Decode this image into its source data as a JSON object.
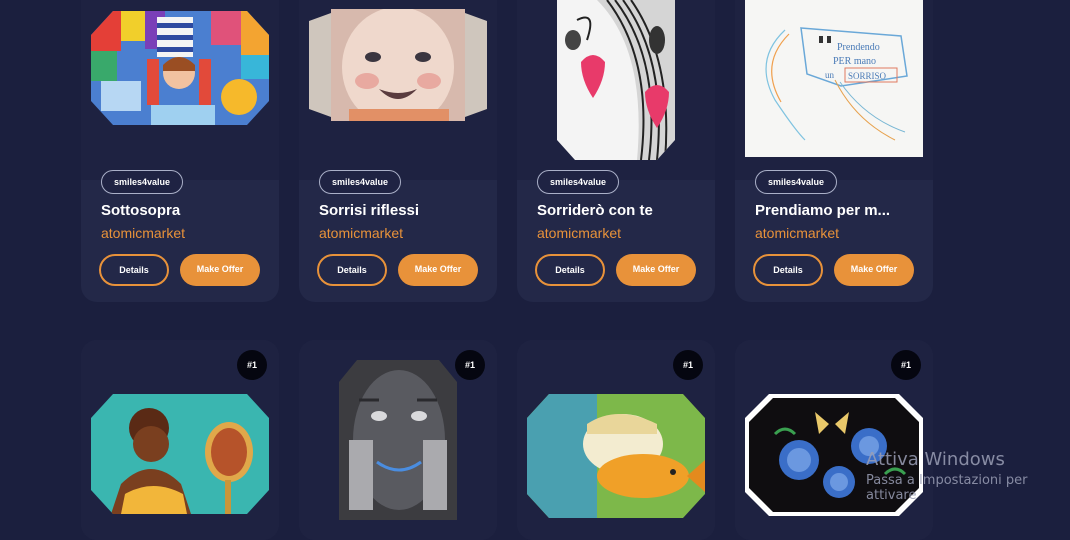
{
  "cards_row1": [
    {
      "collection": "smiles4value",
      "title": "Sottosopra",
      "seller": "atomicmarket",
      "details_label": "Details",
      "offer_label": "Make Offer"
    },
    {
      "collection": "smiles4value",
      "title": "Sorrisi riflessi",
      "seller": "atomicmarket",
      "details_label": "Details",
      "offer_label": "Make Offer"
    },
    {
      "collection": "smiles4value",
      "title": "Sorriderò con te",
      "seller": "atomicmarket",
      "details_label": "Details",
      "offer_label": "Make Offer"
    },
    {
      "collection": "smiles4value",
      "title": "Prendiamo per m...",
      "seller": "atomicmarket",
      "details_label": "Details",
      "offer_label": "Make Offer"
    }
  ],
  "cards_row2": [
    {
      "rank": "#1"
    },
    {
      "rank": "#1"
    },
    {
      "rank": "#1"
    },
    {
      "rank": "#1"
    }
  ],
  "artwork_texts": {
    "prendendo": "Prendendo",
    "per_mano": "PER mano",
    "un": "un",
    "sorriso": "SORRISO"
  },
  "watermark": {
    "line1": "Attiva Windows",
    "line2": "Passa a Impostazioni per attivare"
  },
  "colors": {
    "background": "#1b1f3e",
    "card": "#232848",
    "accent": "#e8923a"
  }
}
